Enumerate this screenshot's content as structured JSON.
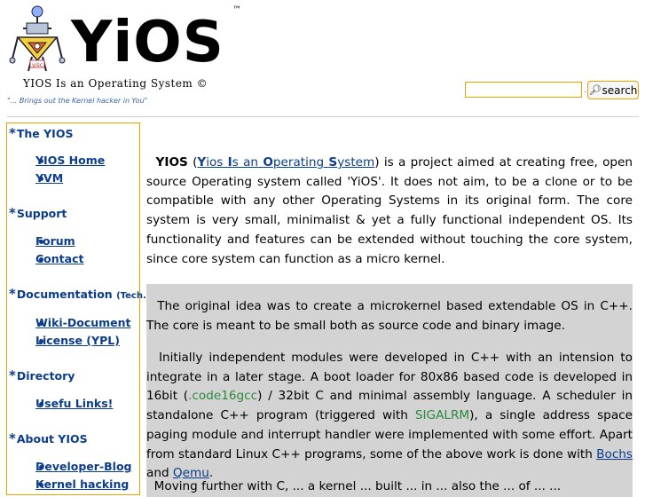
{
  "header": {
    "logo_text": "YiOS",
    "tm": "™",
    "subtitle": "YIOS Is an Operating System ©",
    "tagline": "\"... Brings out the Kernel hacker in You\""
  },
  "search": {
    "button_label": "search",
    "value": "",
    "separator": "."
  },
  "sidebar": {
    "sections": [
      {
        "title": "The YIOS",
        "links": [
          "YIOS Home",
          "YVM"
        ]
      },
      {
        "title": "Support",
        "links": [
          "Forum",
          "Contact"
        ]
      },
      {
        "title": "Documentation",
        "title_suffix": "(Tech.)",
        "links": [
          "Wiki-Document",
          "License (YPL)"
        ]
      },
      {
        "title": "Directory",
        "links": [
          "Usefu Links!"
        ]
      },
      {
        "title": "About YIOS",
        "links": [
          "Developer-Blog",
          "Kernel hacking"
        ]
      }
    ]
  },
  "main": {
    "intro": {
      "name": "YIOS",
      "paren_open": " (",
      "acronym": [
        "Y",
        "ios ",
        "I",
        "s an ",
        "O",
        "perating ",
        "S",
        "ystem"
      ],
      "paren_close": ")",
      "text": " is a project aimed at creating free, open source Operating system called 'YiOS'. It does not aim, to be a clone or to be compatible with any other Operating Systems in its original form. The core system is very small, minimalist & yet a fully functional independent OS. Its functionality and features can be extended without touching the core system, since core system can function as a micro kernel."
    },
    "p1": "The original idea was to create a microkernel based extendable OS in C++. The core is meant to be small both as source code and binary image.",
    "p2": {
      "a": "Initially independent modules were developed in C++ with an intension to integrate in a later stage. A boot loader for 80x86 based code is developed in 16bit (",
      "code16gcc": ".code16gcc",
      "b": ") / 32bit C and minimal assembly language. A scheduler in standalone C++ program (triggered with ",
      "sigalrm": "SIGALRM",
      "c": "), a single address space paging module and interrupt handler were implemented with some effort. Apart from standard Linux C++ programs, some of the above work is done with ",
      "bochs": "Bochs",
      "and": " and ",
      "qemu": "Qemu",
      "end": "."
    },
    "p3_partial": "Moving further with C, ... a kernel ... built ... in ... also the ... of ... ..."
  },
  "colors": {
    "link": "#0b3d8c",
    "accent_border": "#e8a000",
    "box_bg": "#d3d3d3",
    "green_text": "#2b8a3e"
  }
}
